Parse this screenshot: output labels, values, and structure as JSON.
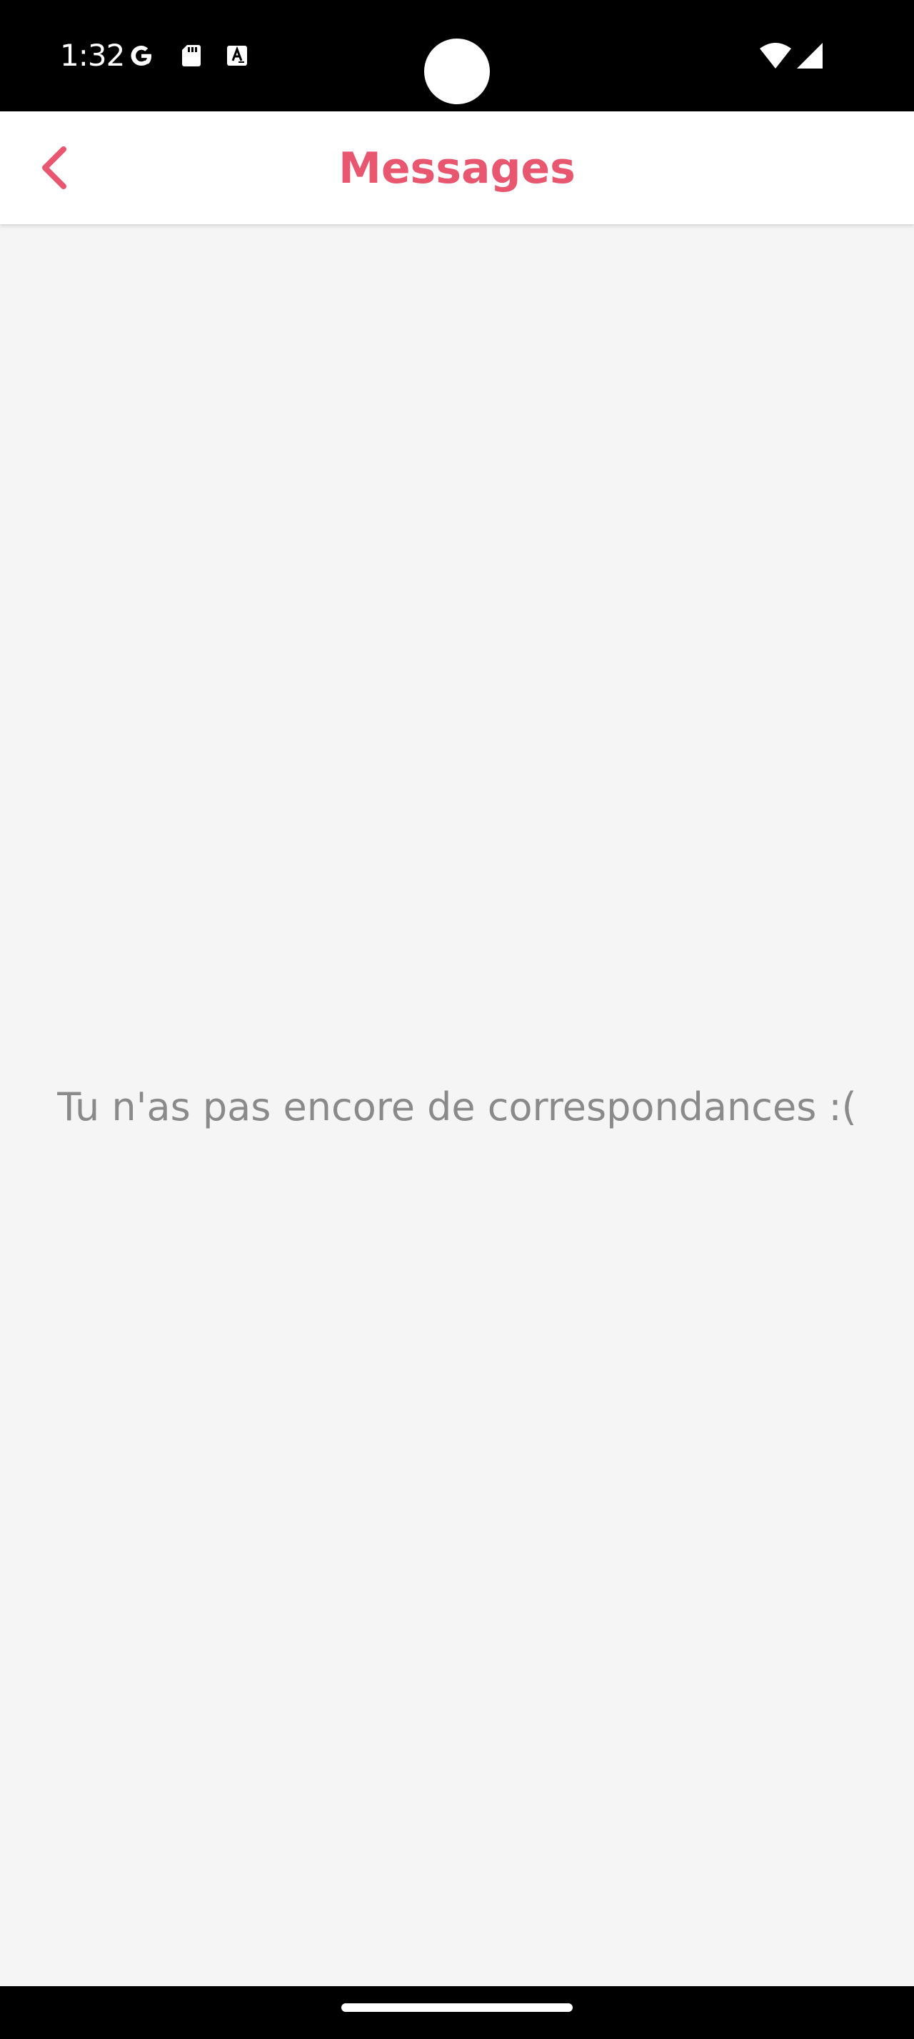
{
  "status_bar": {
    "time": "1:32",
    "left_icons": [
      "google-icon",
      "sd-card-icon",
      "keyboard-a-icon"
    ],
    "right_icons": [
      "wifi-icon",
      "cellular-signal-icon"
    ]
  },
  "header": {
    "back_icon": "chevron-left-icon",
    "title": "Messages",
    "accent_color": "#e8566f"
  },
  "main": {
    "empty_message": "Tu n'as pas encore de correspondances :("
  }
}
